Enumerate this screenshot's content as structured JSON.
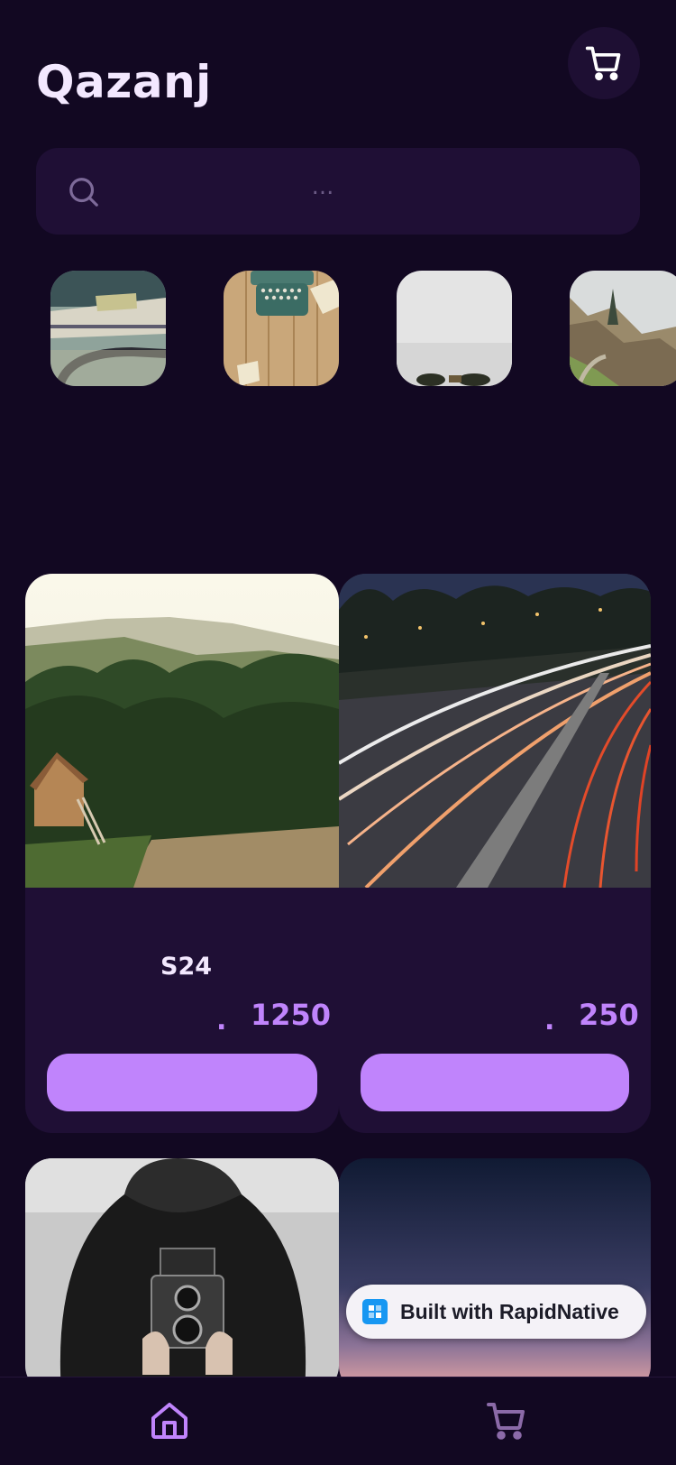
{
  "app": {
    "title": "Qazanj"
  },
  "search": {
    "placeholder": "..."
  },
  "categories": [
    {
      "icon": "category-desk-papers"
    },
    {
      "icon": "category-typewriter"
    },
    {
      "icon": "category-foggy-sky"
    },
    {
      "icon": "category-misty-forest"
    }
  ],
  "products": [
    {
      "name": "S24",
      "currency_dot": ".",
      "price": "1250",
      "image": "mountain-cabin",
      "button_label": ""
    },
    {
      "name": "",
      "currency_dot": ".",
      "price": "250",
      "image": "highway-light-trails",
      "button_label": ""
    },
    {
      "name": "",
      "image": "person-with-camera"
    },
    {
      "name": "",
      "image": "twilight-sky"
    }
  ],
  "badge": {
    "label": "Built with RapidNative"
  },
  "nav": [
    {
      "name": "home",
      "icon": "home-icon",
      "active": true
    },
    {
      "name": "cart",
      "icon": "cart-icon",
      "active": false
    }
  ],
  "colors": {
    "background": "#120822",
    "surface": "#1f0f35",
    "accent": "#c084fc",
    "text": "#f3e8ff"
  }
}
